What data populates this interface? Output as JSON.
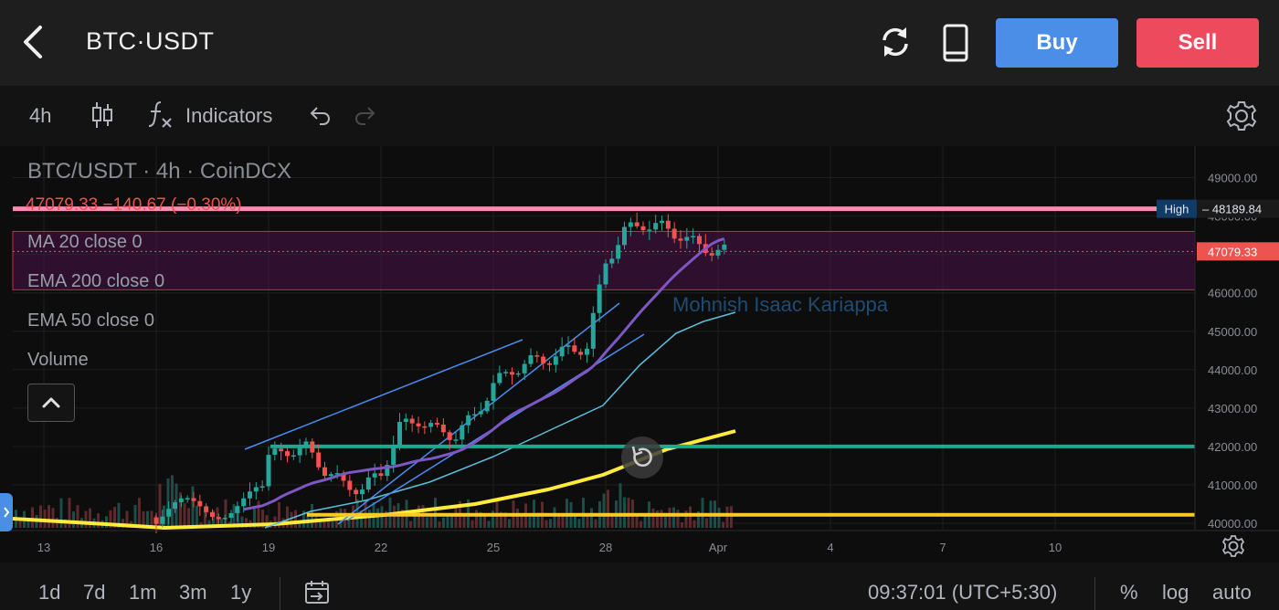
{
  "header": {
    "title": "BTC·USDT",
    "buy_label": "Buy",
    "sell_label": "Sell"
  },
  "toolbar": {
    "interval": "4h",
    "indicators_label": "Indicators"
  },
  "legend": {
    "title": "BTC/USDT · 4h · CoinDCX",
    "price_line": "47079.33  −140.67 (−0.30%)",
    "indicators": [
      "MA 20 close 0",
      "EMA 200 close 0",
      "EMA 50 close 0",
      "Volume"
    ]
  },
  "watermark": "Mohnish Isaac Kariappa",
  "bottom": {
    "ranges": [
      "1d",
      "7d",
      "1m",
      "3m",
      "1y"
    ],
    "time": "09:37:01 (UTC+5:30)",
    "percent_label": "%",
    "log_label": "log",
    "auto_label": "auto"
  },
  "colors": {
    "up": "#26a69a",
    "down": "#ef5350",
    "ma20": "#7e57c2",
    "ema50": "#5bc0de",
    "ema200": "#ffeb3b",
    "trendline": "#2962ff",
    "hline_teal": "#1fa88e",
    "hline_yellow": "#f9c929",
    "hline_pink": "#f48fb1",
    "zone": "#4a1248"
  },
  "chart_data": {
    "type": "candlestick",
    "symbol": "BTC/USDT",
    "timeframe": "4h",
    "exchange": "CoinDCX",
    "y_ticks": [
      40000,
      41000,
      42000,
      43000,
      44000,
      45000,
      46000,
      47000,
      48000,
      49000
    ],
    "y_tick_labels": [
      "40000.00",
      "41000.00",
      "42000.00",
      "43000.00",
      "44000.00",
      "45000.00",
      "46000.00",
      "47000.00",
      "48000.00",
      "49000.00"
    ],
    "x_ticks": [
      "13",
      "16",
      "19",
      "22",
      "25",
      "28",
      "Apr",
      "4",
      "7",
      "10"
    ],
    "high_label": "High",
    "high_value": "48189.84",
    "last_price": "47079.33",
    "horizontal_lines": [
      48189.84,
      42000,
      40220
    ],
    "zone": [
      46080,
      47600
    ],
    "close_path": [
      [
        19.0,
        41700
      ],
      [
        19.5,
        41900
      ],
      [
        20.0,
        41950
      ],
      [
        20.5,
        41400
      ],
      [
        21.0,
        41000
      ],
      [
        21.5,
        40900
      ],
      [
        22.0,
        41300
      ],
      [
        22.5,
        42500
      ],
      [
        23.0,
        42700
      ],
      [
        23.5,
        42400
      ],
      [
        24.0,
        42300
      ],
      [
        24.5,
        42800
      ],
      [
        25.0,
        43600
      ],
      [
        25.5,
        44000
      ],
      [
        26.0,
        44200
      ],
      [
        26.5,
        44300
      ],
      [
        27.0,
        44500
      ],
      [
        27.5,
        44600
      ],
      [
        28.0,
        46800
      ],
      [
        28.5,
        47600
      ],
      [
        29.0,
        47800
      ],
      [
        29.5,
        47700
      ],
      [
        30.0,
        47500
      ],
      [
        30.5,
        47200
      ],
      [
        31.0,
        47100
      ],
      [
        31.2,
        47079.33
      ]
    ]
  }
}
